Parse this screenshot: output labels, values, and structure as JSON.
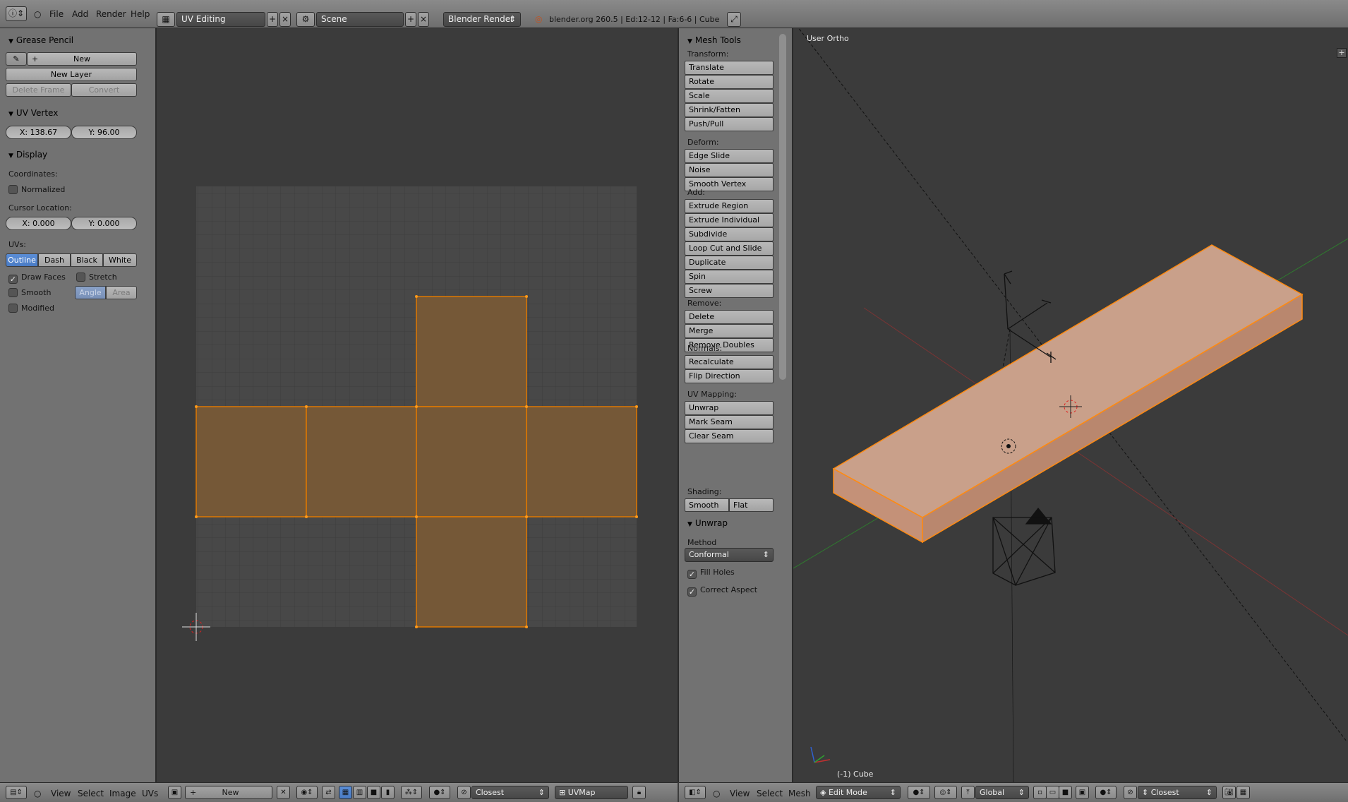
{
  "topbar": {
    "menus": [
      "File",
      "Add",
      "Render",
      "Help"
    ],
    "layout": "UV Editing",
    "scene": "Scene",
    "engine": "Blender Render",
    "info": "blender.org 260.5 | Ed:12-12 | Fa:6-6 | Cube"
  },
  "left_panel": {
    "grease_pencil": {
      "title": "Grease Pencil",
      "new": "New",
      "new_layer": "New Layer",
      "delete_frame": "Delete Frame",
      "convert": "Convert"
    },
    "uv_vertex": {
      "title": "UV Vertex",
      "x": "X: 138.67",
      "y": "Y: 96.00"
    },
    "display": {
      "title": "Display",
      "coordinates": "Coordinates:",
      "normalized": "Normalized",
      "cursor_location": "Cursor Location:",
      "cursor_x": "X: 0.000",
      "cursor_y": "Y: 0.000",
      "uvs": "UVs:",
      "uv_modes": [
        "Outline",
        "Dash",
        "Black",
        "White"
      ],
      "draw_faces": "Draw Faces",
      "stretch": "Stretch",
      "smooth": "Smooth",
      "angle": "Angle",
      "area": "Area",
      "modified": "Modified"
    }
  },
  "uv_bottom": {
    "menus": [
      "View",
      "Select",
      "Image",
      "UVs"
    ],
    "image_new": "New",
    "snap": "Closest",
    "uvmap": "UVMap"
  },
  "mesh_tools": {
    "title": "Mesh Tools",
    "groups": [
      {
        "label": "Transform:",
        "items": [
          "Translate",
          "Rotate",
          "Scale",
          "Shrink/Fatten",
          "Push/Pull"
        ]
      },
      {
        "label": "Deform:",
        "items": [
          "Edge Slide",
          "Noise",
          "Smooth Vertex"
        ]
      },
      {
        "label": "Add:",
        "items": [
          "Extrude Region",
          "Extrude Individual",
          "Subdivide",
          "Loop Cut and Slide",
          "Duplicate",
          "Spin",
          "Screw"
        ]
      },
      {
        "label": "Remove:",
        "items": [
          "Delete",
          "Merge",
          "Remove Doubles"
        ]
      },
      {
        "label": "Normals:",
        "items": [
          "Recalculate",
          "Flip Direction"
        ]
      },
      {
        "label": "UV Mapping:",
        "items": [
          "Unwrap",
          "Mark Seam",
          "Clear Seam"
        ]
      }
    ],
    "shading_label": "Shading:",
    "shading_smooth": "Smooth",
    "shading_flat": "Flat"
  },
  "unwrap": {
    "title": "Unwrap",
    "method_label": "Method",
    "method": "Conformal",
    "fill_holes": "Fill Holes",
    "correct_aspect": "Correct Aspect"
  },
  "viewport": {
    "view_name": "User Ortho",
    "object_label": "(-1) Cube"
  },
  "view3d_bottom": {
    "menus": [
      "View",
      "Select",
      "Mesh"
    ],
    "mode": "Edit Mode",
    "orientation": "Global",
    "snap": "Closest"
  },
  "colors": {
    "uv_face": "#7a5a36",
    "uv_edge": "#e07800",
    "mesh_face": "#c9a08a",
    "accent": "#5a8ed8"
  }
}
